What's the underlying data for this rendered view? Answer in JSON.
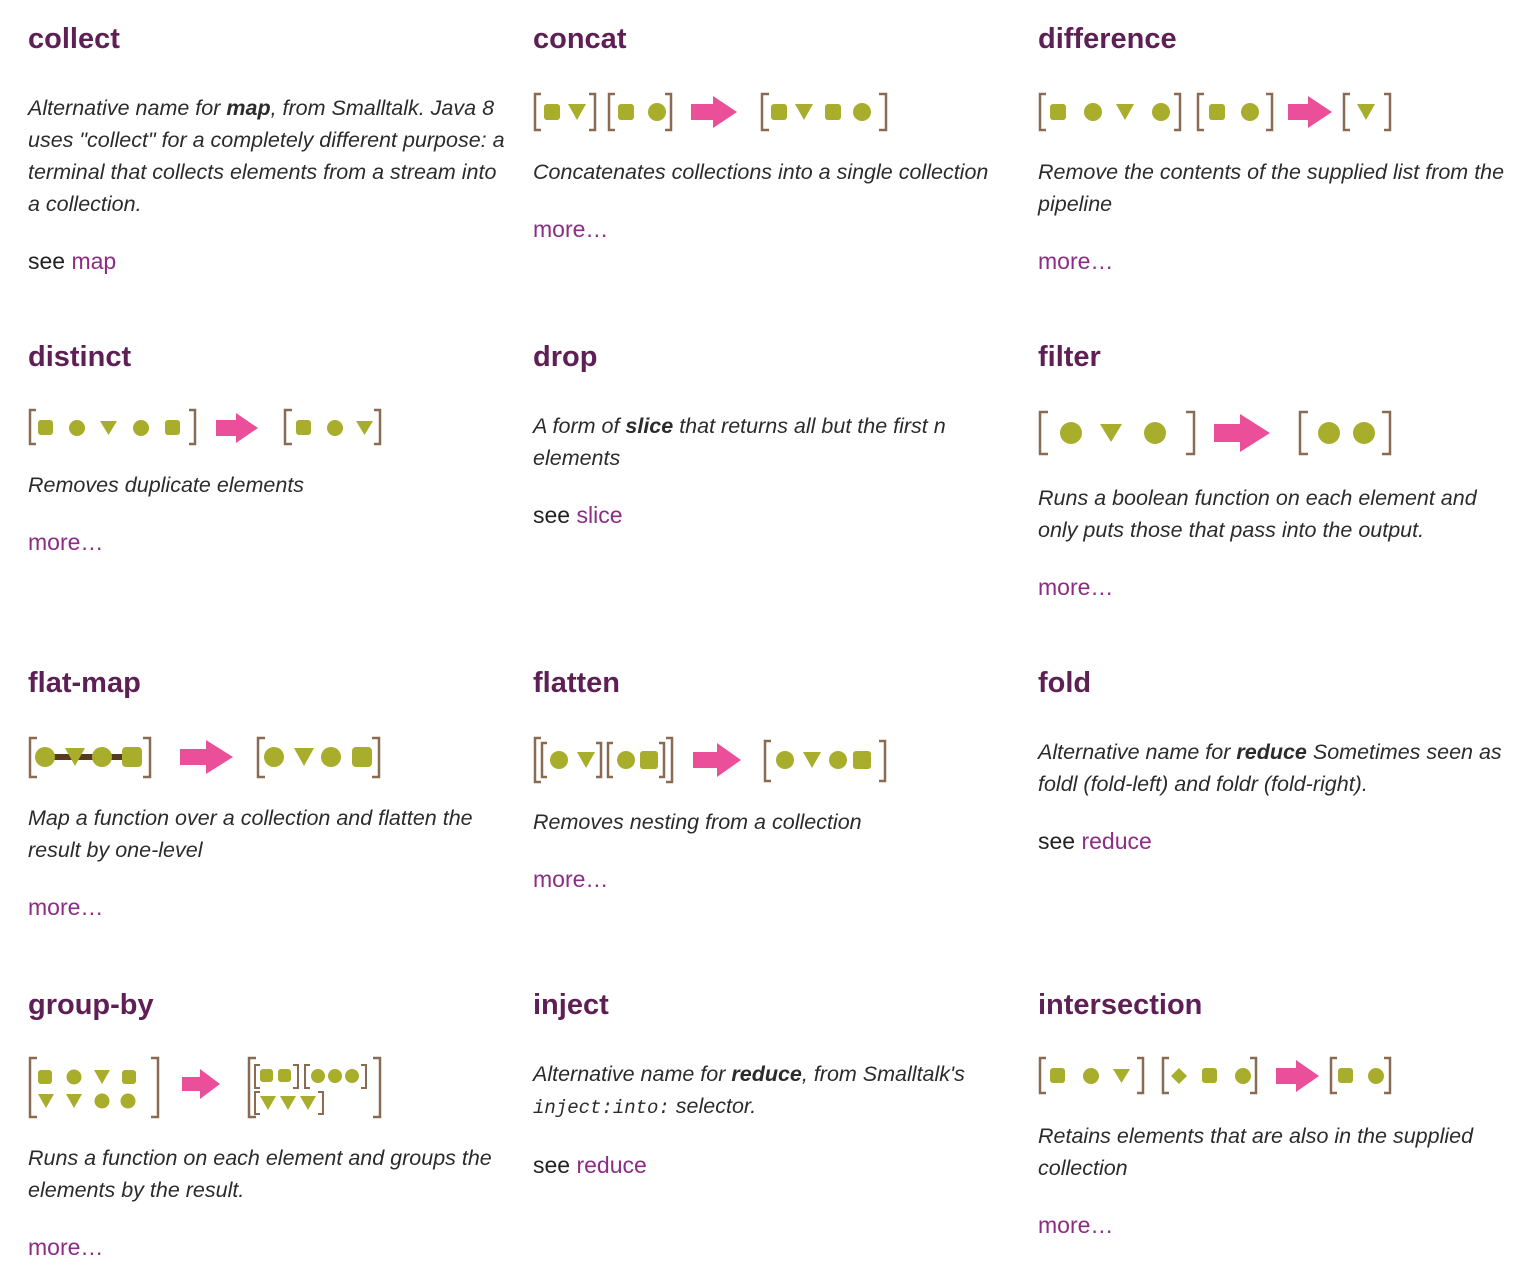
{
  "colors": {
    "title": "#5e1f55",
    "link": "#8b2c85",
    "text": "#2b2b2b",
    "bracket": "#8b6a52",
    "element": "#a8ad2b",
    "arrow": "#ec4f9a",
    "connector": "#5a3a1e"
  },
  "entries": {
    "collect": {
      "title": "collect",
      "desc_pre": "Alternative name for ",
      "desc_bold": "map",
      "desc_post": ", from Smalltalk. Java 8 uses \"collect\" for a completely different purpose: a terminal that collects elements from a stream into a collection.",
      "see_label": "see",
      "link": "map"
    },
    "concat": {
      "title": "concat",
      "desc": "Concatenates collections into a single collection",
      "more": "more…"
    },
    "difference": {
      "title": "difference",
      "desc": "Remove the contents of the supplied list from the pipeline",
      "more": "more…"
    },
    "distinct": {
      "title": "distinct",
      "desc": "Removes duplicate elements",
      "more": "more…"
    },
    "drop": {
      "title": "drop",
      "desc_pre": "A form of ",
      "desc_bold": "slice",
      "desc_post": " that returns all but the first n elements",
      "see_label": "see",
      "link": "slice"
    },
    "filter": {
      "title": "filter",
      "desc": "Runs a boolean function on each element and only puts those that pass into the output.",
      "more": "more…"
    },
    "flat_map": {
      "title": "flat-map",
      "desc": "Map a function over a collection and flatten the result by one-level",
      "more": "more…"
    },
    "flatten": {
      "title": "flatten",
      "desc": "Removes nesting from a collection",
      "more": "more…"
    },
    "fold": {
      "title": "fold",
      "desc_pre": "Alternative name for ",
      "desc_bold": "reduce",
      "desc_post": " Sometimes seen as foldl (fold-left) and foldr (fold-right).",
      "see_label": "see",
      "link": "reduce"
    },
    "group_by": {
      "title": "group-by",
      "desc": "Runs a function on each element and groups the elements by the result.",
      "more": "more…"
    },
    "inject": {
      "title": "inject",
      "desc_pre": "Alternative name for ",
      "desc_bold": "reduce",
      "desc_mid": ", from Smalltalk's ",
      "desc_code": "inject:into:",
      "desc_post": " selector.",
      "see_label": "see",
      "link": "reduce"
    },
    "intersection": {
      "title": "intersection",
      "desc": "Retains elements that are also in the supplied collection",
      "more": "more…"
    }
  }
}
